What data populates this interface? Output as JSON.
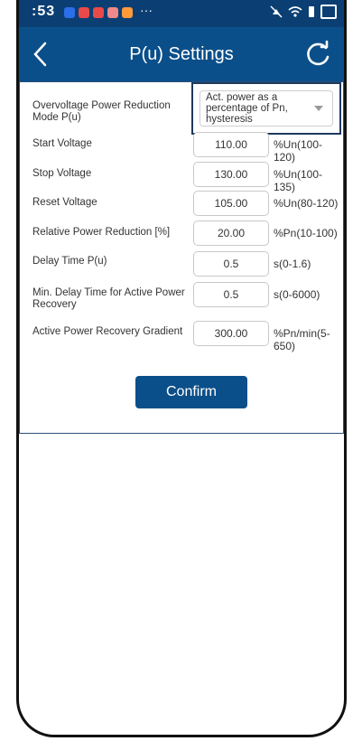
{
  "statusbar": {
    "time": ":53",
    "notification_colors": [
      "#2a6fe8",
      "#e84a4a",
      "#e84a4a",
      "#f08a8a",
      "#ff9a3a"
    ],
    "overflow": "···",
    "icons": [
      "mute-icon",
      "wifi-icon",
      "signal-icon",
      "battery-icon"
    ]
  },
  "header": {
    "title": "P(u) Settings",
    "back_icon": "chevron-left-icon",
    "refresh_icon": "refresh-icon"
  },
  "form": {
    "mode": {
      "label": "Overvoltage Power Reduction Mode P(u)",
      "value": "Act. power as a percentage of Pn, hysteresis"
    },
    "rows": [
      {
        "label": "Start Voltage",
        "value": "110.00",
        "unit": "%Un(100-120)"
      },
      {
        "label": "Stop Voltage",
        "value": "130.00",
        "unit": "%Un(100-135)"
      },
      {
        "label": "Reset Voltage",
        "value": "105.00",
        "unit": "%Un(80-120)"
      },
      {
        "label": "Relative Power Reduction [%]",
        "value": "20.00",
        "unit": "%Pn(10-100)"
      },
      {
        "label": "Delay Time P(u)",
        "value": "0.5",
        "unit": "s(0-1.6)"
      },
      {
        "label": "Min. Delay Time for Active Power Recovery",
        "value": "0.5",
        "unit": "s(0-6000)"
      },
      {
        "label": "Active Power Recovery Gradient",
        "value": "300.00",
        "unit": "%Pn/min(5-650)"
      }
    ],
    "confirm_label": "Confirm"
  },
  "colors": {
    "header": "#0b4f8a",
    "statusbar": "#0b3f73",
    "button": "#0b4f8a"
  }
}
